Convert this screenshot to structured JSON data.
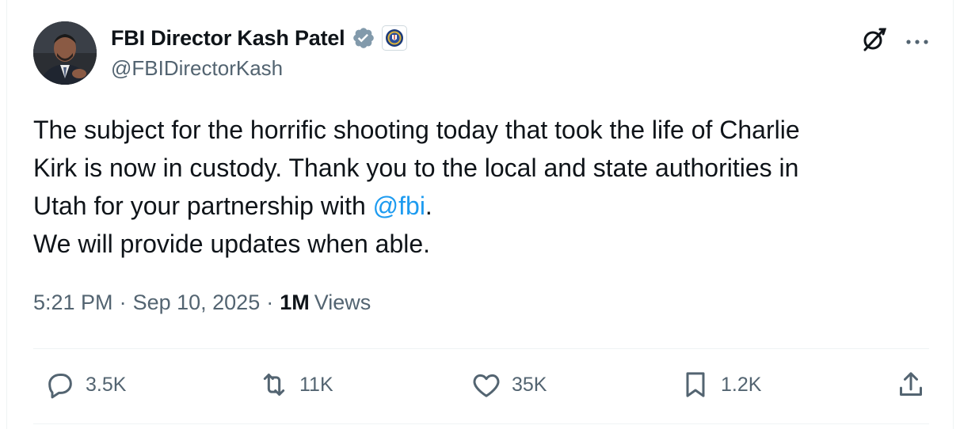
{
  "author": {
    "display_name": "FBI Director Kash Patel",
    "handle": "@FBIDirectorKash",
    "verified_badge_color": "#829aab",
    "affiliation": "fbi-seal-icon"
  },
  "tweet": {
    "line1": "The subject for the horrific shooting today that took the life of Charlie",
    "line2": "Kirk is now in custody. Thank you to the local and state authorities in",
    "line3_prefix": "Utah for your partnership with ",
    "mention": "@fbi",
    "line3_suffix": ".",
    "line4": "We will provide updates when able."
  },
  "meta": {
    "time": "5:21 PM",
    "dot1": "·",
    "date": "Sep 10, 2025",
    "dot2": "·",
    "views_count": "1M",
    "views_label": "Views"
  },
  "actions": {
    "replies": "3.5K",
    "reposts": "11K",
    "likes": "35K",
    "bookmarks": "1.2K"
  },
  "icons": {
    "top_right": [
      "grok-icon",
      "more-icon"
    ],
    "bar": [
      "reply-icon",
      "repost-icon",
      "like-icon",
      "bookmark-icon",
      "share-icon"
    ]
  },
  "colors": {
    "text": "#0f1419",
    "secondary": "#536471",
    "link": "#1d9bf0",
    "divider": "#eff3f4"
  }
}
